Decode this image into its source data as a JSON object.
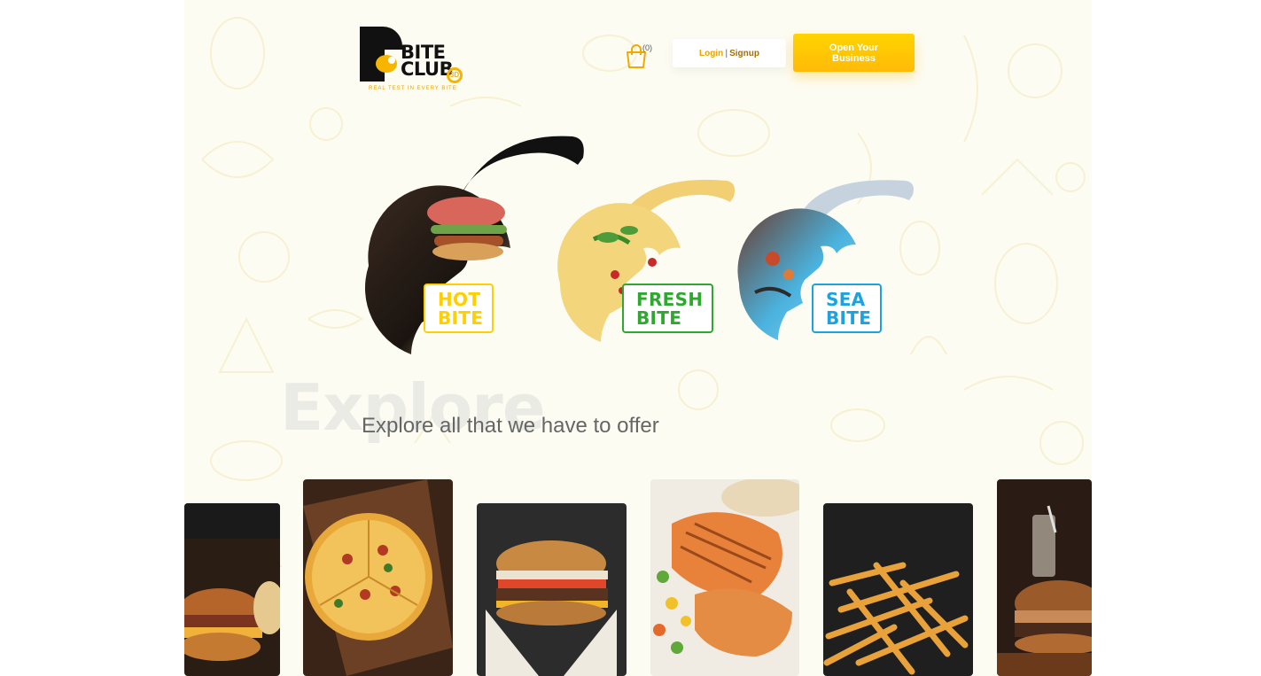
{
  "brand": {
    "name_line1": "BITE",
    "name_line2": "CLUB",
    "badge": "3D",
    "tagline": "REAL TEST IN EVERY BITE"
  },
  "header": {
    "cart_count": "(0)",
    "login_label": "Login",
    "separator": "|",
    "signup_label": "Signup",
    "cta_label": "Open Your Business"
  },
  "categories": [
    {
      "line1": "HOT",
      "line2": "BITE",
      "color": "#ffcf00"
    },
    {
      "line1": "FRESH",
      "line2": "BITE",
      "color": "#2ea82e"
    },
    {
      "line1": "SEA",
      "line2": "BITE",
      "color": "#1aa3e0"
    }
  ],
  "explore": {
    "background_word": "Explore",
    "subtitle": "Explore all that we have to offer"
  },
  "cards": [
    {
      "icon": "burger-bacon-image"
    },
    {
      "icon": "pizza-image"
    },
    {
      "icon": "burger-image"
    },
    {
      "icon": "grilled-chicken-image"
    },
    {
      "icon": "french-fries-image"
    },
    {
      "icon": "burger-drink-image"
    }
  ],
  "colors": {
    "accent": "#ffc400",
    "page_bg": "#fdfcf3"
  }
}
